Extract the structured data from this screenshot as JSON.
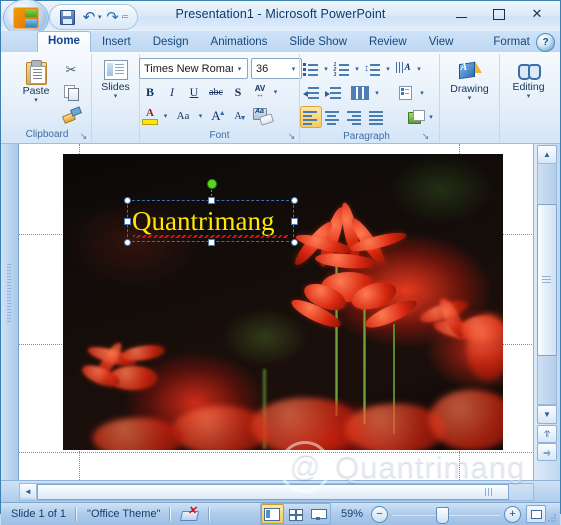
{
  "window": {
    "title": "Presentation1 - Microsoft PowerPoint",
    "minimize_label": "Minimize",
    "maximize_label": "Maximize",
    "close_label": "✕"
  },
  "quick_access": {
    "office_button": "Office Button",
    "items": [
      {
        "name": "save-icon",
        "label": "Save"
      },
      {
        "name": "undo-icon",
        "label": "↶"
      },
      {
        "name": "undo-dropdown-icon",
        "label": "▾"
      },
      {
        "name": "redo-icon",
        "label": "↷"
      },
      {
        "name": "customize-qat-icon",
        "label": "▾"
      }
    ]
  },
  "tabs": [
    {
      "label": "Home",
      "active": true
    },
    {
      "label": "Insert",
      "active": false
    },
    {
      "label": "Design",
      "active": false
    },
    {
      "label": "Animations",
      "active": false
    },
    {
      "label": "Slide Show",
      "active": false
    },
    {
      "label": "Review",
      "active": false
    },
    {
      "label": "View",
      "active": false
    },
    {
      "label": "Format",
      "active": false
    }
  ],
  "help": {
    "label": "?"
  },
  "ribbon": {
    "clipboard": {
      "group_label": "Clipboard",
      "paste_label": "Paste",
      "paste_arrow": "▾",
      "cut_label": "Cut",
      "copy_label": "Copy",
      "format_painter_label": "Format Painter",
      "dialog_launcher": "↘"
    },
    "slides": {
      "group_label": "Slides",
      "slides_label": "Slides",
      "slides_arrow": "▾"
    },
    "font": {
      "group_label": "Font",
      "font_name": "Times New Roman",
      "font_size": "36",
      "dropdown_arrow": "▾",
      "bold": "B",
      "italic": "I",
      "underline": "U",
      "strikethrough": "abc",
      "shadow": "S",
      "spacing_top": "AV",
      "spacing_bottom": "↔",
      "font_color": "A",
      "change_case": "Aa",
      "grow_font": "A",
      "shrink_font": "A",
      "clear_formatting": "Aa",
      "dialog_launcher": "↘"
    },
    "paragraph": {
      "group_label": "Paragraph",
      "bullets_label": "Bullets",
      "numbering_label": "Numbering",
      "line_spacing_label": "Line Spacing",
      "text_direction_label": "Text Direction",
      "decrease_indent_label": "Decrease List Level",
      "increase_indent_label": "Increase List Level",
      "columns_label": "Columns",
      "align_text_label": "Align Text",
      "smartart_label": "Convert to SmartArt",
      "align_left_label": "Align Text Left",
      "align_center_label": "Center",
      "align_right_label": "Align Text Right",
      "justify_label": "Justify",
      "dialog_launcher": "↘"
    },
    "drawing": {
      "group_label": "Drawing",
      "arrow": "▾"
    },
    "editing": {
      "group_label": "Editing",
      "arrow": "▾"
    }
  },
  "slide": {
    "textbox_value": "Quantrimang",
    "textbox_font_color": "#ffe800",
    "spellcheck_underline_color": "#e01010",
    "rotation_handle_color": "#5ad71e"
  },
  "scrollbars": {
    "up_arrow": "▲",
    "down_arrow": "▼",
    "previous_slide": "⥣",
    "next_slide": "⥤",
    "left_arrow": "◄",
    "right_arrow": "►"
  },
  "status_bar": {
    "slide_count": "Slide 1 of 1",
    "theme": "\"Office Theme\"",
    "spellcheck_label": "Spelling Check",
    "view_normal": "Normal View",
    "view_sorter": "Slide Sorter",
    "view_show": "Slide Show",
    "zoom_value": "59%",
    "zoom_out": "−",
    "zoom_in": "+",
    "fit_label": "Fit slide to current window"
  },
  "watermark": {
    "text": "Quantrimang"
  }
}
